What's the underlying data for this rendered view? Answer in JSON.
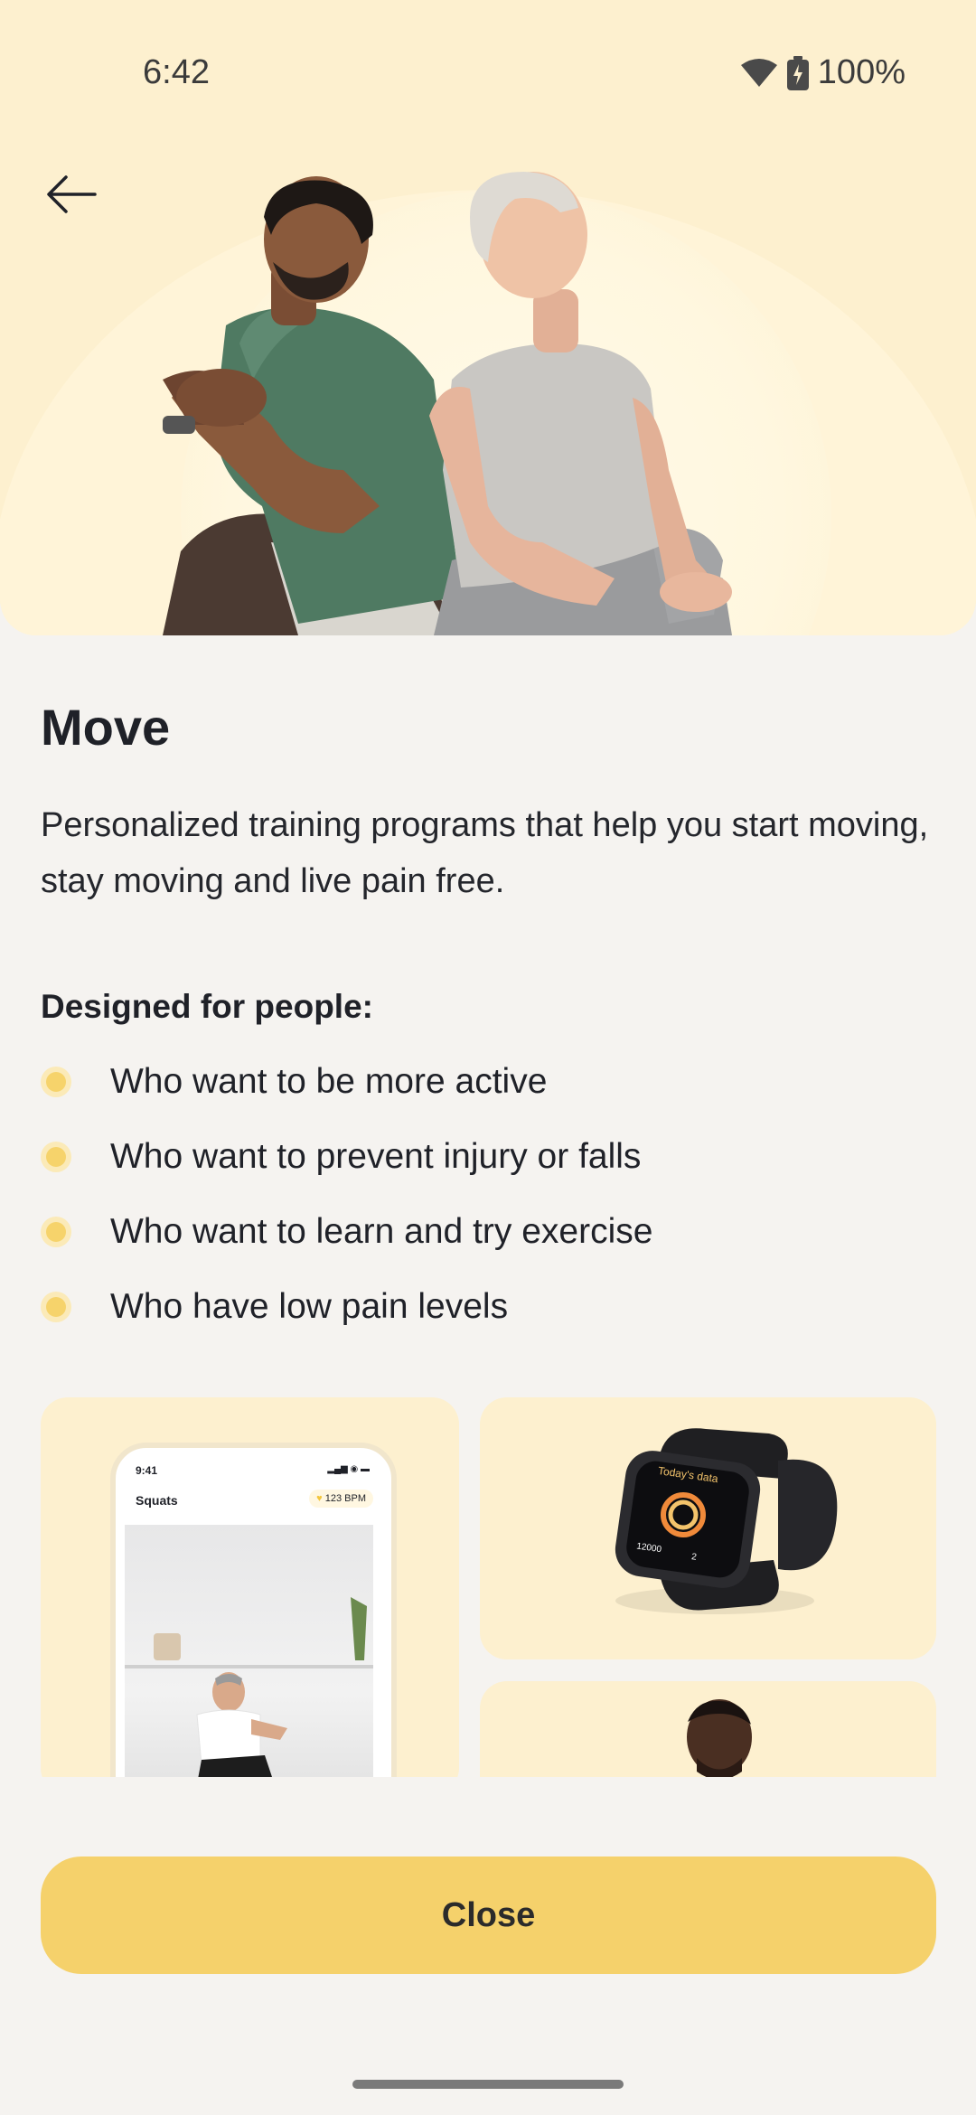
{
  "status_bar": {
    "time": "6:42",
    "battery": "100%"
  },
  "hero": {
    "back_icon": "arrow-back-icon"
  },
  "content": {
    "title": "Move",
    "description": "Personalized training programs that help you start moving, stay moving and live pain free.",
    "designed_for_heading": "Designed for people:",
    "bullets": [
      "Who want to be more active",
      "Who want to prevent injury or falls",
      "Who want to learn and try exercise",
      "Who have low pain levels"
    ]
  },
  "gallery": {
    "phone": {
      "time": "9:41",
      "title": "Squats",
      "bpm": "123 BPM"
    },
    "watch": {
      "screen_title": "Today's data",
      "value_left": "12000",
      "value_right": "2"
    }
  },
  "actions": {
    "close_label": "Close"
  },
  "colors": {
    "accent": "#f5d16b",
    "hero_bg": "#fdf0cf",
    "bullet": "#f6d36b",
    "page_bg": "#f5f3f0"
  }
}
